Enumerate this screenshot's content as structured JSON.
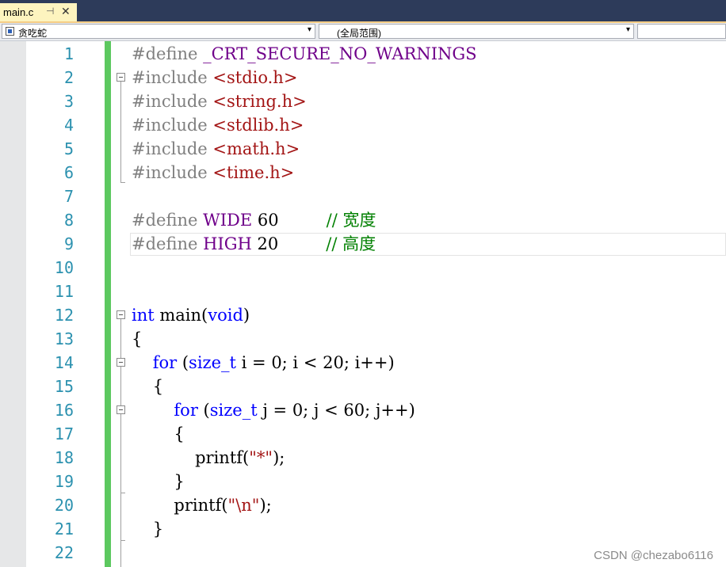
{
  "tab": {
    "title": "main.c",
    "pin_icon": "pin-icon",
    "close_icon": "close-icon"
  },
  "navbar": {
    "project": "贪吃蛇",
    "scope": "(全局范围)"
  },
  "editor": {
    "line_numbers": [
      "1",
      "2",
      "3",
      "4",
      "5",
      "6",
      "7",
      "8",
      "9",
      "10",
      "11",
      "12",
      "13",
      "14",
      "15",
      "16",
      "17",
      "18",
      "19",
      "20",
      "21",
      "22"
    ],
    "lines": [
      [
        {
          "c": "pp",
          "t": "#define "
        },
        {
          "c": "mac",
          "t": "_CRT_SECURE_NO_WARNINGS"
        }
      ],
      [
        {
          "c": "pp",
          "t": "#include "
        },
        {
          "c": "str",
          "t": "<stdio.h>"
        }
      ],
      [
        {
          "c": "pp",
          "t": "#include "
        },
        {
          "c": "str",
          "t": "<string.h>"
        }
      ],
      [
        {
          "c": "pp",
          "t": "#include "
        },
        {
          "c": "str",
          "t": "<stdlib.h>"
        }
      ],
      [
        {
          "c": "pp",
          "t": "#include "
        },
        {
          "c": "str",
          "t": "<math.h>"
        }
      ],
      [
        {
          "c": "pp",
          "t": "#include "
        },
        {
          "c": "str",
          "t": "<time.h>"
        }
      ],
      [],
      [
        {
          "c": "pp",
          "t": "#define "
        },
        {
          "c": "mac",
          "t": "WIDE"
        },
        {
          "c": "plain",
          "t": " 60         "
        },
        {
          "c": "cm",
          "t": "// 宽度"
        }
      ],
      [
        {
          "c": "pp",
          "t": "#define "
        },
        {
          "c": "mac",
          "t": "HIGH"
        },
        {
          "c": "plain",
          "t": " 20         "
        },
        {
          "c": "cm",
          "t": "// 高度"
        }
      ],
      [],
      [],
      [
        {
          "c": "kw",
          "t": "int"
        },
        {
          "c": "plain",
          "t": " main("
        },
        {
          "c": "kw",
          "t": "void"
        },
        {
          "c": "plain",
          "t": ")"
        }
      ],
      [
        {
          "c": "plain",
          "t": "{"
        }
      ],
      [
        {
          "c": "plain",
          "t": "    "
        },
        {
          "c": "kw",
          "t": "for"
        },
        {
          "c": "plain",
          "t": " ("
        },
        {
          "c": "kw",
          "t": "size_t"
        },
        {
          "c": "plain",
          "t": " i = 0; i < 20; i++)"
        }
      ],
      [
        {
          "c": "plain",
          "t": "    {"
        }
      ],
      [
        {
          "c": "plain",
          "t": "        "
        },
        {
          "c": "kw",
          "t": "for"
        },
        {
          "c": "plain",
          "t": " ("
        },
        {
          "c": "kw",
          "t": "size_t"
        },
        {
          "c": "plain",
          "t": " j = 0; j < 60; j++)"
        }
      ],
      [
        {
          "c": "plain",
          "t": "        {"
        }
      ],
      [
        {
          "c": "plain",
          "t": "            printf("
        },
        {
          "c": "str",
          "t": "\"*\""
        },
        {
          "c": "plain",
          "t": ");"
        }
      ],
      [
        {
          "c": "plain",
          "t": "        }"
        }
      ],
      [
        {
          "c": "plain",
          "t": "        printf("
        },
        {
          "c": "str",
          "t": "\"\\n\""
        },
        {
          "c": "plain",
          "t": ");"
        }
      ],
      [
        {
          "c": "plain",
          "t": "    }"
        }
      ],
      []
    ]
  },
  "watermark": "CSDN @chezabo6116"
}
